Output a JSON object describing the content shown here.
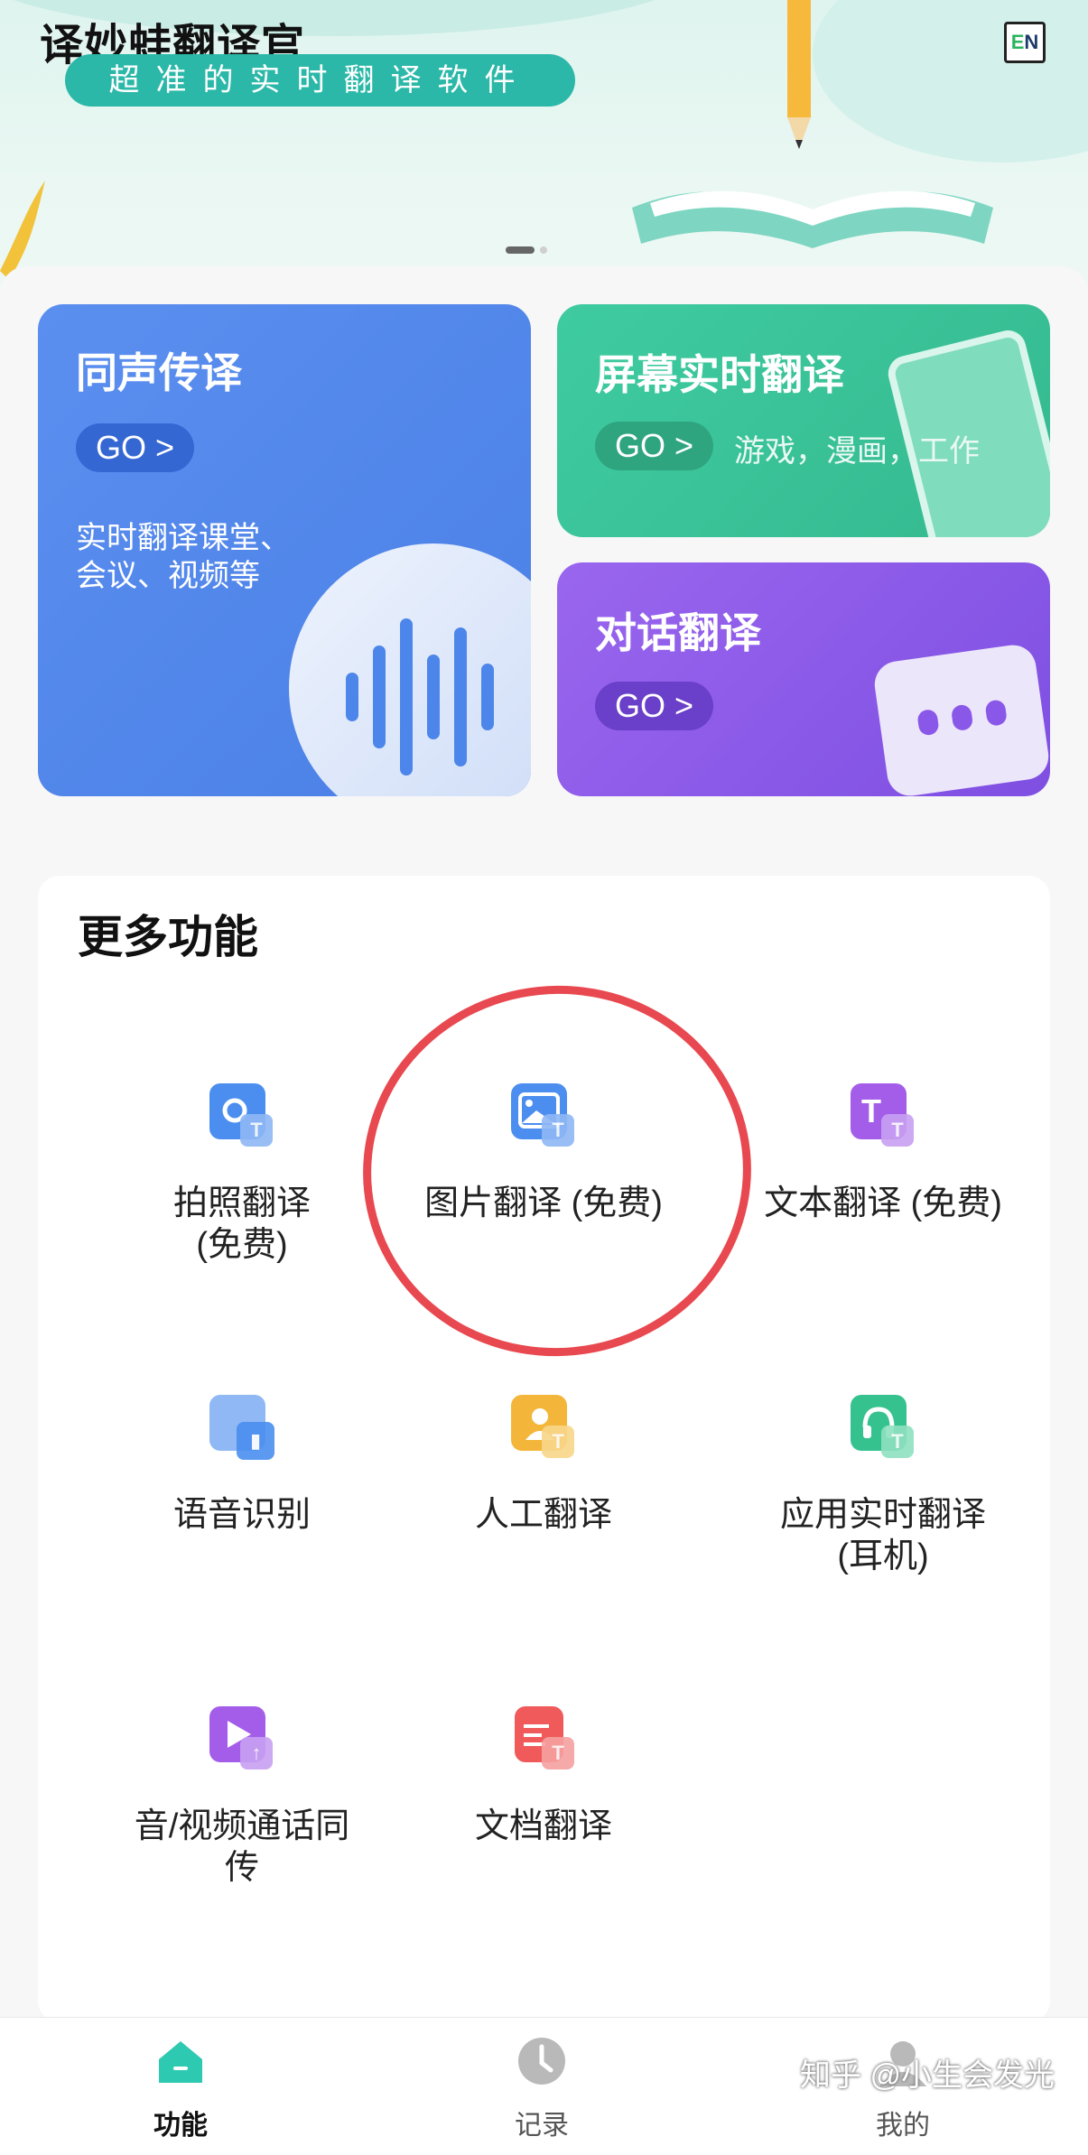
{
  "banner": {
    "app_title": "译妙蛙翻译官",
    "slogan": "超准的实时翻译软件",
    "lang_badge": "EN",
    "carousel_active_index": 0
  },
  "cards": {
    "simultaneous": {
      "title": "同声传译",
      "go": "GO >",
      "desc_line1": "实时翻译课堂、",
      "desc_line2": "会议、视频等",
      "color": "#5b8fef"
    },
    "screen": {
      "title": "屏幕实时翻译",
      "go": "GO >",
      "sub": "游戏，漫画，工作",
      "color": "#3fcba0"
    },
    "dialog": {
      "title": "对话翻译",
      "go": "GO >",
      "color": "#9a66ee"
    }
  },
  "more": {
    "title": "更多功能",
    "items": [
      {
        "label": "拍照翻译\n(免费)",
        "icon": "camera-translate-icon",
        "color": "#4b8ef0"
      },
      {
        "label": "图片翻译 (免费)",
        "icon": "image-translate-icon",
        "color": "#4b8ef0"
      },
      {
        "label": "文本翻译 (免费)",
        "icon": "text-translate-icon",
        "color": "#a45de8"
      },
      {
        "label": "语音识别",
        "icon": "voice-recognition-icon",
        "color": "#4b8ef0"
      },
      {
        "label": "人工翻译",
        "icon": "human-translate-icon",
        "color": "#f3b63a"
      },
      {
        "label": "应用实时翻译\n(耳机)",
        "icon": "headphone-translate-icon",
        "color": "#36c28f"
      },
      {
        "label": "音/视频通话同\n传",
        "icon": "video-call-icon",
        "color": "#a45de8"
      },
      {
        "label": "文档翻译",
        "icon": "document-translate-icon",
        "color": "#f05a5a"
      }
    ]
  },
  "annotation_color": "#e8484f",
  "tabs": [
    {
      "label": "功能",
      "icon": "home-icon",
      "active": true
    },
    {
      "label": "记录",
      "icon": "clock-icon",
      "active": false
    },
    {
      "label": "我的",
      "icon": "profile-icon",
      "active": false
    }
  ],
  "watermark": "知乎 @小生会发光"
}
